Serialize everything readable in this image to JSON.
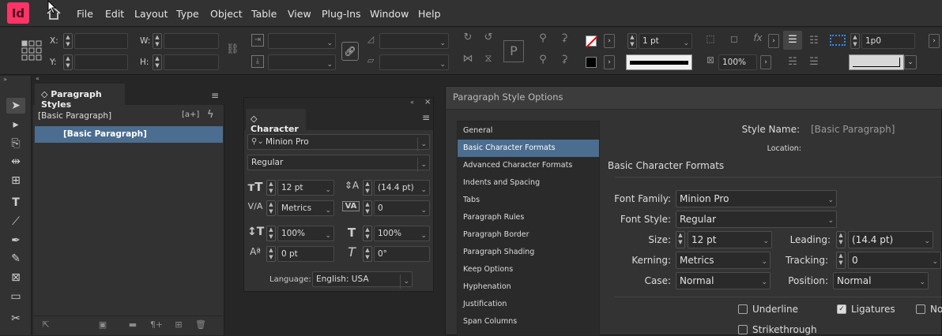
{
  "app": {
    "logo_text": "Id",
    "brand_color": "#ff3366"
  },
  "menu": [
    "File",
    "Edit",
    "Layout",
    "Type",
    "Object",
    "Table",
    "View",
    "Plug-Ins",
    "Window",
    "Help"
  ],
  "control": {
    "x_label": "X:",
    "y_label": "Y:",
    "w_label": "W:",
    "h_label": "H:",
    "stroke_weight": "1 pt",
    "opacity": "100%",
    "gap": "1p0"
  },
  "para_styles": {
    "title": "Paragraph Styles",
    "basic_header": "[Basic Paragraph]",
    "create_icon_text": "[a+]",
    "selected": "[Basic Paragraph]"
  },
  "character": {
    "title": "Character",
    "font_family": "Minion Pro",
    "font_style": "Regular",
    "size": "12 pt",
    "leading": "(14.4 pt)",
    "kerning": "Metrics",
    "tracking": "0",
    "vscale": "100%",
    "hscale": "100%",
    "baseline": "0 pt",
    "skew": "0°",
    "language_label": "Language:",
    "language": "English: USA"
  },
  "dialog": {
    "title": "Paragraph Style Options",
    "categories": [
      "General",
      "Basic Character Formats",
      "Advanced Character Formats",
      "Indents and Spacing",
      "Tabs",
      "Paragraph Rules",
      "Paragraph Border",
      "Paragraph Shading",
      "Keep Options",
      "Hyphenation",
      "Justification",
      "Span Columns"
    ],
    "selected_index": 1,
    "style_name_label": "Style Name:",
    "style_name": "[Basic Paragraph]",
    "location_label": "Location:",
    "section_title": "Basic Character Formats",
    "font_family_label": "Font Family:",
    "font_family": "Minion Pro",
    "font_style_label": "Font Style:",
    "font_style": "Regular",
    "size_label": "Size:",
    "size": "12 pt",
    "leading_label": "Leading:",
    "leading": "(14.4 pt)",
    "kerning_label": "Kerning:",
    "kerning": "Metrics",
    "tracking_label": "Tracking:",
    "tracking": "0",
    "case_label": "Case:",
    "case": "Normal",
    "position_label": "Position:",
    "position": "Normal",
    "underline_label": "Underline",
    "underline": false,
    "ligatures_label": "Ligatures",
    "ligatures": true,
    "strikethrough_label": "Strikethrough",
    "strikethrough": false,
    "no_break_label": "No"
  }
}
